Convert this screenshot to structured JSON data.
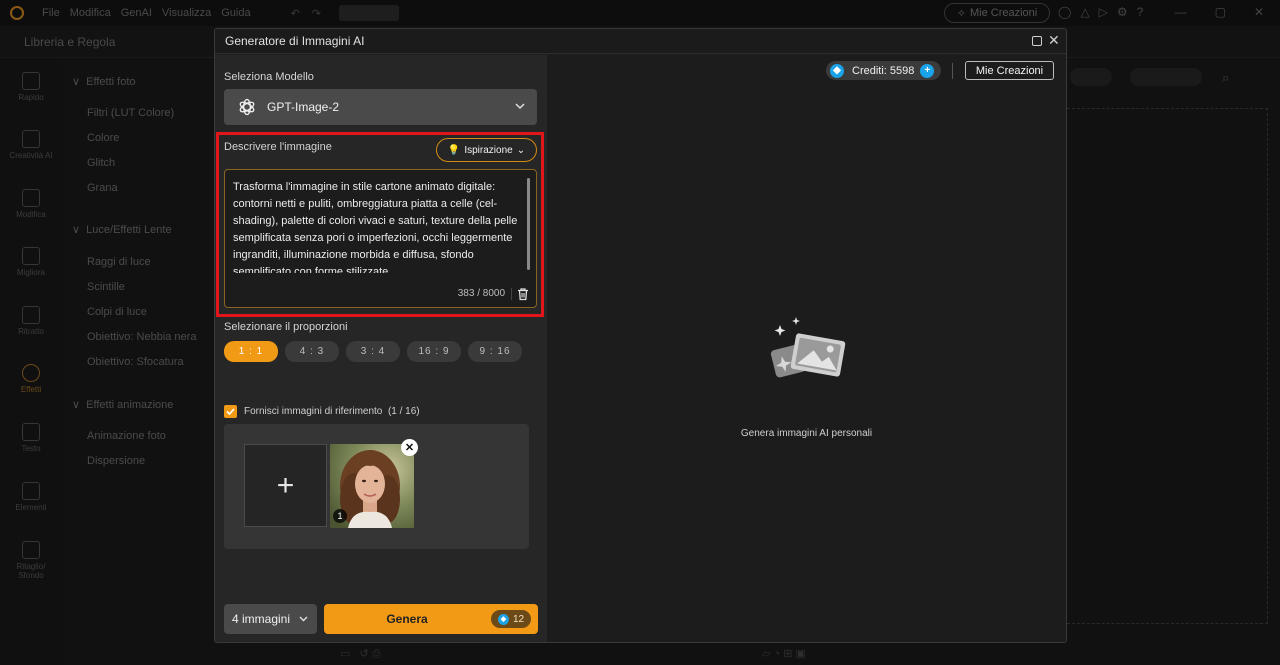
{
  "topbar": {
    "menu": [
      "File",
      "Modifica",
      "GenAI",
      "Visualizza",
      "Guida"
    ],
    "mie_creazioni": "Mie Creazioni"
  },
  "subbar": {
    "libreria": "Libreria e Regola"
  },
  "rail": {
    "items": [
      "Rapido",
      "Creatività AI",
      "Modifica",
      "Migliora",
      "Ritratto",
      "Effetti",
      "Testo",
      "Elementi",
      "Ritaglio/\nSfondo"
    ]
  },
  "panel": {
    "sections": [
      {
        "title": "Effetti foto",
        "items": [
          "Filtri (LUT Colore)",
          "Colore",
          "Glitch",
          "Grana"
        ]
      },
      {
        "title": "Luce/Effetti Lente",
        "items": [
          "Raggi di luce",
          "Scintille",
          "Colpi di luce",
          "Obiettivo: Nebbia nera",
          "Obiettivo: Sfocatura"
        ]
      },
      {
        "title": "Effetti animazione",
        "items": [
          "Animazione foto",
          "Dispersione"
        ]
      }
    ]
  },
  "modal": {
    "title": "Generatore di Immagini AI",
    "model_label": "Seleziona Modello",
    "model_value": "GPT-Image-2",
    "describe_label": "Descrivere l'immagine",
    "inspiration_label": "Ispirazione",
    "prompt_text": "Trasforma l'immagine in stile cartone animato digitale: contorni netti e puliti, ombreggiatura piatta a celle (cel-shading), palette di colori vivaci e saturi, texture della pelle semplificata senza pori o imperfezioni, occhi leggermente ingranditi, illuminazione morbida e diffusa, sfondo semplificato con forme stilizzate.",
    "char_count": "383 / 8000",
    "ratio_label": "Selezionare il proporzioni",
    "ratios": [
      "1 : 1",
      "4 : 3",
      "3 : 4",
      "16 : 9",
      "9 : 16"
    ],
    "selected_ratio": "1 : 1",
    "reference_label": "Fornisci immagini di riferimento",
    "reference_count": "(1 / 16)",
    "reference_badge": "1",
    "count_value": "4 immagini",
    "generate_label": "Genera",
    "generate_cost": "12",
    "credits_label": "Crediti: 5598",
    "my_creations": "Mie Creazioni",
    "empty_text": "Genera immagini AI personali"
  },
  "colors": {
    "accent": "#f19a16",
    "highlight_frame": "#e0161b",
    "credit_blue": "#1aa3e8"
  }
}
